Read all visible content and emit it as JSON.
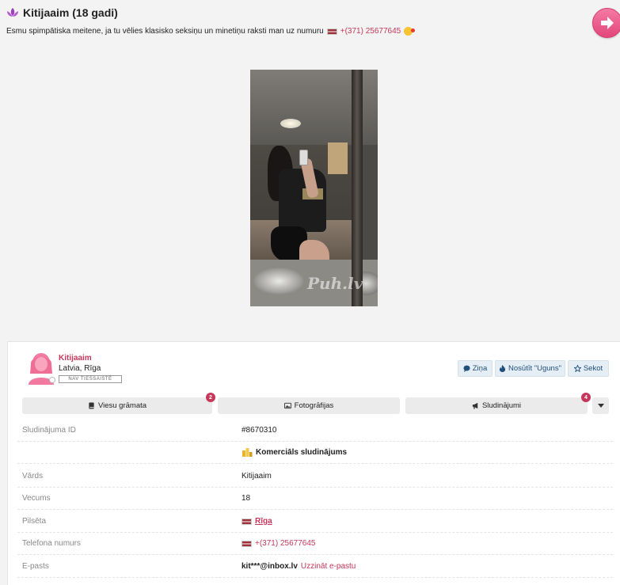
{
  "header": {
    "title": "Kitijaaim (18 gadi)",
    "description": "Esmu spimpātiska meitene, ja tu vēlies klasisko seksiņu un minetiņu raksti man uz numuru",
    "phone": "+(371) 25677645"
  },
  "photo": {
    "watermark": "Puh.lv"
  },
  "profile": {
    "username": "Kitijaaim",
    "location": "Latvia, Rīga",
    "status": "NAV TIEŠSAISTĒ"
  },
  "actions": {
    "message": "Ziņa",
    "fire": "Nosūtīt \"Uguns\"",
    "follow": "Sekot"
  },
  "tabs": [
    {
      "label": "Viesu grāmata",
      "badge": "2"
    },
    {
      "label": "Fotogrāfijas"
    },
    {
      "label": "Sludinājumi",
      "badge": "4"
    }
  ],
  "details": {
    "ad_id": {
      "label": "Sludinājuma ID",
      "value": "#8670310"
    },
    "commercial": "Komerciāls sludinājums",
    "name": {
      "label": "Vārds",
      "value": "Kitijaaim"
    },
    "age": {
      "label": "Vecums",
      "value": "18"
    },
    "city": {
      "label": "Pilsēta",
      "value": "Rīga"
    },
    "phone": {
      "label": "Telefona numurs",
      "value": "+(371) 25677645"
    },
    "email": {
      "label": "E-pasts",
      "value": "kit***@inbox.lv",
      "link": "Uzzināt e-pastu"
    }
  },
  "colors": {
    "accent": "#c5385c",
    "button_bg": "#e6eef5",
    "page_bg": "#f3f3f3"
  }
}
